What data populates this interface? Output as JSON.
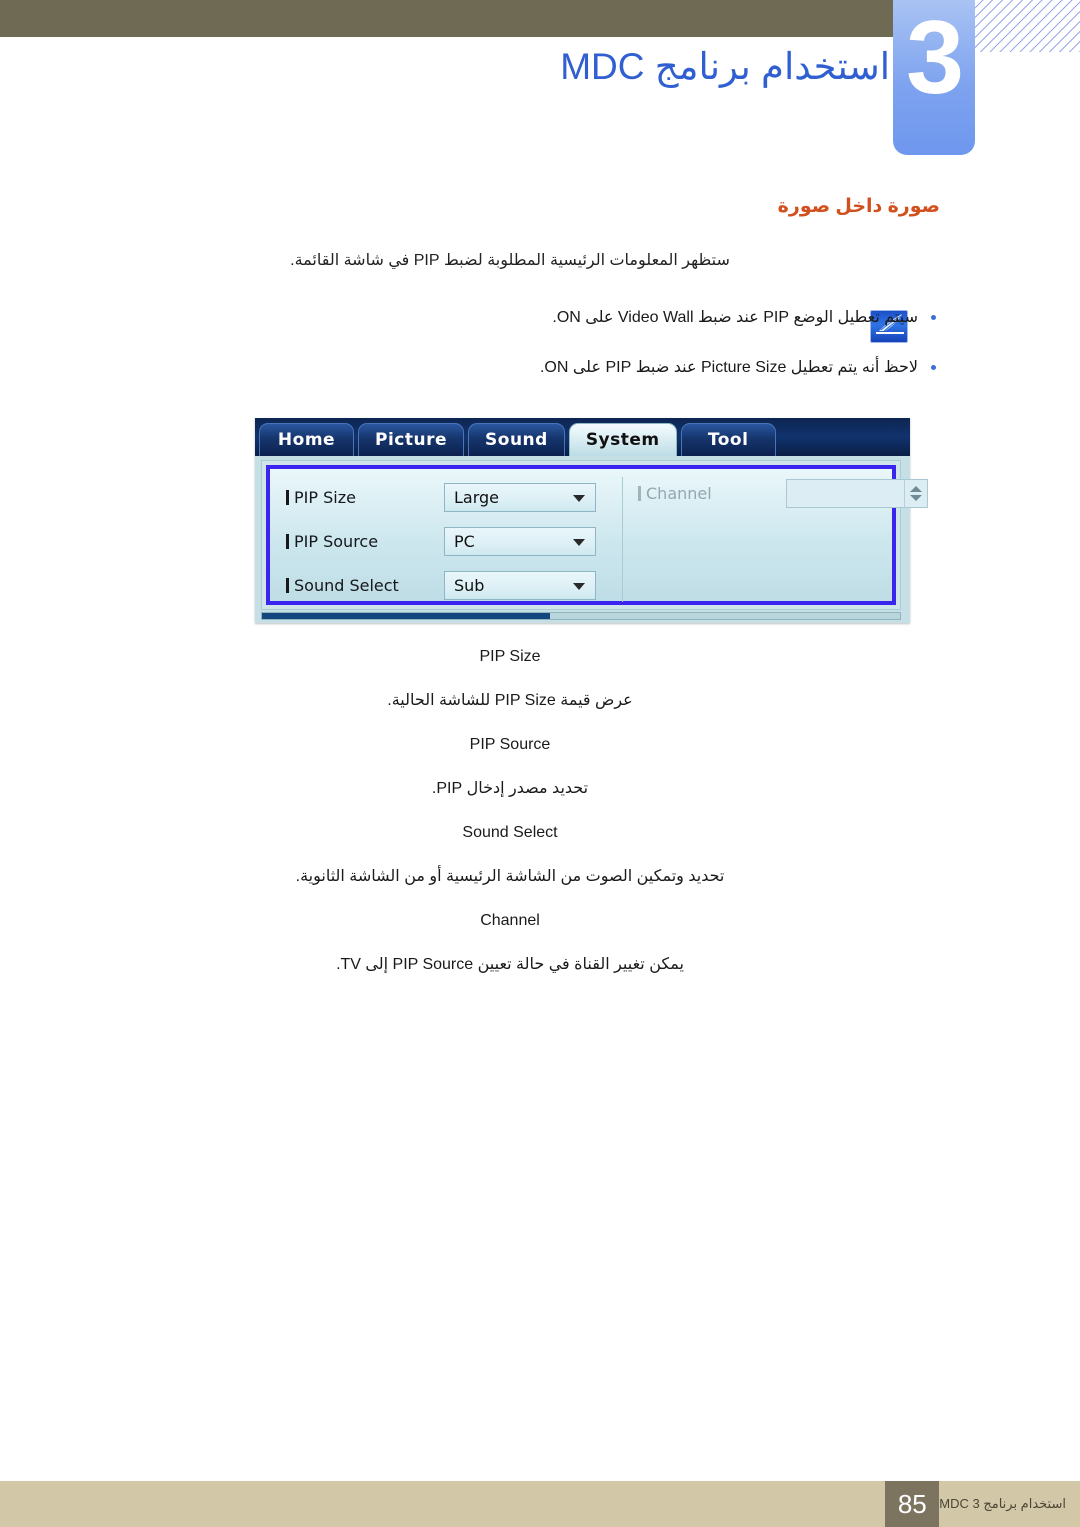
{
  "header": {
    "chapter_number": "3",
    "chapter_title": "استخدام برنامج MDC",
    "band_color": "#6e6a54",
    "block_color": "#7ea3ef",
    "title_color": "#2f5fd0"
  },
  "section": {
    "title": "صورة داخل صورة",
    "title_color": "#d2501e",
    "intro": "ستظهر المعلومات الرئيسية المطلوبة لضبط PIP في شاشة القائمة.",
    "note_icon": "note-pen-icon",
    "bullets": [
      "سيتم تعطيل الوضع PIP عند ضبط Video Wall على ON.",
      "لاحظ أنه يتم تعطيل Picture Size عند ضبط PIP على ON."
    ]
  },
  "mdc_window": {
    "tabs": [
      {
        "label": "Home",
        "active": false
      },
      {
        "label": "Picture",
        "active": false
      },
      {
        "label": "Sound",
        "active": false
      },
      {
        "label": "System",
        "active": true
      },
      {
        "label": "Tool",
        "active": false
      }
    ],
    "fields": [
      {
        "label": "PIP Size",
        "value": "Large",
        "type": "combobox",
        "enabled": true
      },
      {
        "label": "PIP Source",
        "value": "PC",
        "type": "combobox",
        "enabled": true
      },
      {
        "label": "Sound Select",
        "value": "Sub",
        "type": "combobox",
        "enabled": true
      }
    ],
    "channel": {
      "label": "Channel",
      "value": "",
      "type": "spinner",
      "enabled": false
    },
    "accent_border_color": "#3a25f0"
  },
  "descriptions": [
    {
      "term": "PIP Size",
      "body": "عرض قيمة PIP Size للشاشة الحالية."
    },
    {
      "term": "PIP Source",
      "body": "تحديد مصدر إدخال PIP."
    },
    {
      "term": "Sound Select",
      "body": "تحديد وتمكين الصوت من الشاشة الرئيسية أو من الشاشة الثانوية."
    },
    {
      "term": "Channel",
      "body": "يمكن تغيير القناة في حالة تعيين PIP Source إلى TV."
    }
  ],
  "footer": {
    "text": "استخدام برنامج MDC 3",
    "page": "85",
    "band_color": "#d2c7a7",
    "page_color": "#7d7460"
  }
}
